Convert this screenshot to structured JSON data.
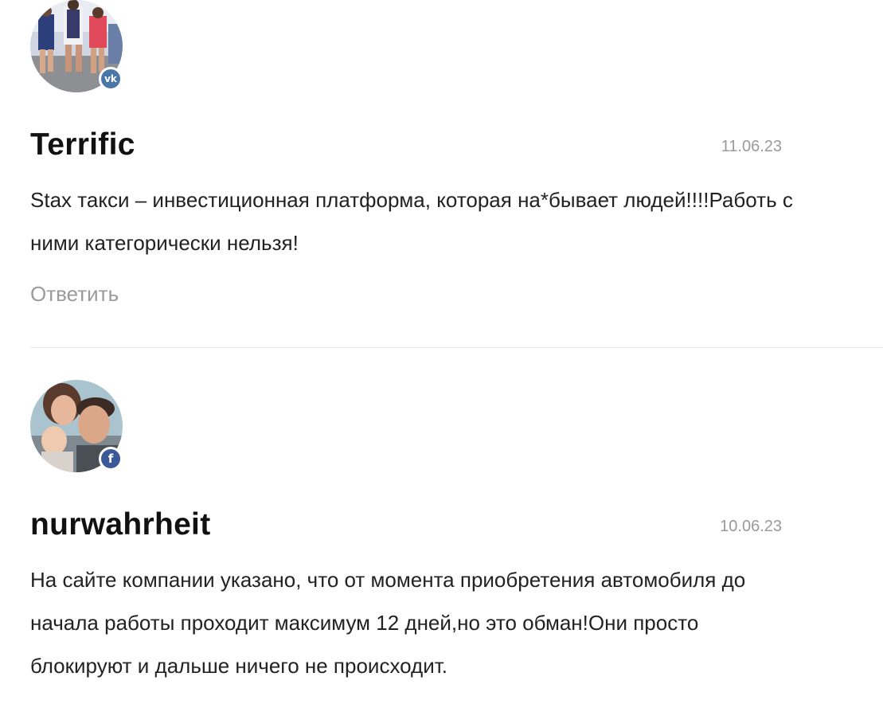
{
  "comments": [
    {
      "author": "Terrific",
      "date": "11.06.23",
      "text": "Stax такси – инвестиционная платформа, которая на*бывает людей!!!!Работь с ними категорически нельзя!",
      "reply_label": "Ответить",
      "social": "vk",
      "social_label": "vk",
      "social_color": "#4a76a8"
    },
    {
      "author": "nurwahrheit",
      "date": "10.06.23",
      "text": "На сайте компании указано, что от момента приобретения автомобиля до начала работы проходит максимум 12 дней,но это обман!Они просто блокируют и дальше ничего не происходит.",
      "social": "facebook",
      "social_label": "f",
      "social_color": "#3b5998"
    }
  ]
}
